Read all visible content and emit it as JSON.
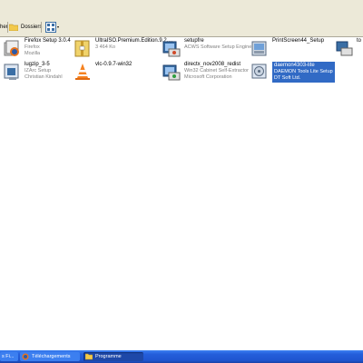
{
  "toolbar": {
    "back_label": "her",
    "folders_label": "Dossiers"
  },
  "files": [
    {
      "name": "Firefox Setup 3.0.4",
      "sub1": "Firefox",
      "sub2": "Mozilla"
    },
    {
      "name": "UltraISO.Premium.Edition.9.2....",
      "sub1": "3 464 Ko",
      "sub2": ""
    },
    {
      "name": "setupfre",
      "sub1": "ACWS Software Setup Engine",
      "sub2": ""
    },
    {
      "name": "PrintScreen44_Setup",
      "sub1": "",
      "sub2": ""
    },
    {
      "name": "to",
      "sub1": "",
      "sub2": ""
    },
    {
      "name": "lugzip_3-5",
      "sub1": "IZArc Setup",
      "sub2": "Christian Kindahl"
    },
    {
      "name": "vlc-0.9.7-win32",
      "sub1": "",
      "sub2": ""
    },
    {
      "name": "directx_nov2008_redist",
      "sub1": "Win32 Cabinet Self-Extractor",
      "sub2": "Microsoft Corporation"
    },
    {
      "name": "daemon4303-lite",
      "sub1": "DAEMON Tools Lite Setup",
      "sub2": "DT Soft Ltd."
    }
  ],
  "taskbar": {
    "item1": "s Fi...",
    "item2": "Téléchargements",
    "item3": "Programme"
  },
  "colors": {
    "selection": "#316ac5",
    "taskbar": "#245edb"
  }
}
